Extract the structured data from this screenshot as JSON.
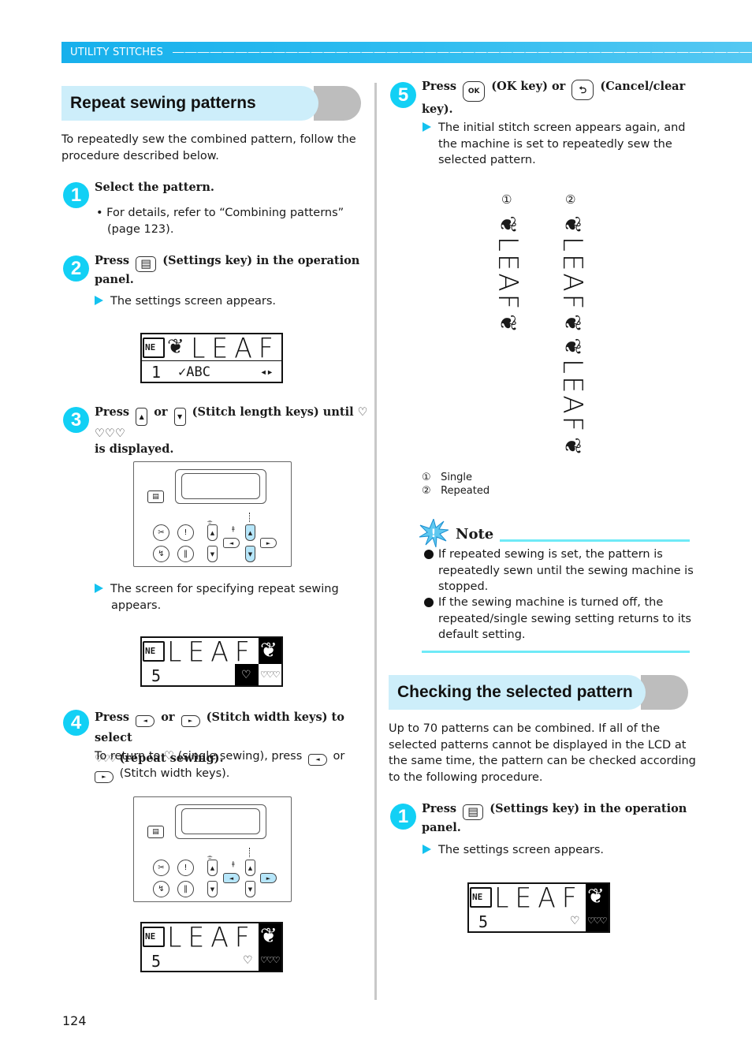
{
  "header": {
    "section_label": "UTILITY STITCHES"
  },
  "left": {
    "title": "Repeat sewing patterns",
    "intro": [
      "To repeatedly sew the combined pattern, follow the",
      "procedure described below."
    ],
    "step1": {
      "num": "1",
      "title": "Select the pattern.",
      "bullet_lines": [
        "• For details, refer to “Combining patterns”",
        "(page 123)."
      ]
    },
    "step2": {
      "num": "2",
      "title_press": "Press",
      "title_rest_line1": "(Settings key) in the operation",
      "title_line2": "panel.",
      "result": "The settings screen appears."
    },
    "lcd1": {
      "ne": "NE",
      "word": "LEAF",
      "number": "1",
      "sub": "✓ABC",
      "arrows": "◂▸"
    },
    "step3": {
      "num": "3",
      "press": "Press",
      "or": "or",
      "rest": "(Stitch length keys) until",
      "hearts": "♡ ♡♡♡",
      "line2": "is displayed.",
      "result_lines": [
        "The screen for specifying repeat sewing",
        "appears."
      ]
    },
    "lcd2": {
      "ne": "NE",
      "word": "LEAF",
      "number": "5",
      "single": "♡",
      "repeat": "♡♡♡"
    },
    "step4": {
      "num": "4",
      "press": "Press",
      "or": "or",
      "rest": "(Stitch width keys) to select",
      "line2": "(repeat sewing).",
      "line2_icon": "♡♡♡",
      "body1_a": "To return to",
      "body1_icon": "♡",
      "body1_b": "(single sewing), press",
      "body1_or": "or",
      "body2": "(Stitch width keys)."
    },
    "lcd3": {
      "ne": "NE",
      "word": "LEAF",
      "number": "5",
      "single": "♡",
      "repeat": "♡♡♡"
    },
    "page_number": "124"
  },
  "right": {
    "step5": {
      "num": "5",
      "press": "Press",
      "ok_key": "OK",
      "ok_text": "(OK key) or",
      "cancel_text": "(Cancel/clear",
      "line2": "key).",
      "result_lines": [
        "The initial stitch screen appears again, and",
        "the machine is set to repeatedly sew the",
        "selected pattern."
      ]
    },
    "illustration": {
      "marker1": "①",
      "marker2": "②",
      "single_word": "LEAF",
      "repeated_word": "LEAF",
      "legend": [
        {
          "marker": "①",
          "label": "Single"
        },
        {
          "marker": "②",
          "label": "Repeated"
        }
      ]
    },
    "note": {
      "title": "Note",
      "items": [
        [
          "If repeated sewing is set, the pattern is",
          "repeatedly sewn until the sewing machine is",
          "stopped."
        ],
        [
          "If the sewing machine is turned off, the",
          "repeated/single sewing setting returns to its",
          "default setting."
        ]
      ]
    },
    "title2": "Checking the selected pattern",
    "intro2": [
      "Up to 70 patterns can be combined. If all of the",
      "selected patterns cannot be displayed in the LCD at",
      "the same time, the pattern can be checked according",
      "to the following procedure."
    ],
    "stepB1": {
      "num": "1",
      "press": "Press",
      "rest": "(Settings key) in the operation",
      "line2": "panel.",
      "result": "The settings screen appears."
    },
    "lcd4": {
      "ne": "NE",
      "word": "LEAF",
      "number": "5",
      "single": "♡",
      "repeat": "♡♡♡"
    }
  },
  "colors": {
    "accent_cyan": "#12d0f5",
    "header_blue": "#17b0ec",
    "title_bg": "#cdeefa",
    "cap_grey": "#bdbdbd",
    "key_highlight": "#b6e6fa"
  }
}
